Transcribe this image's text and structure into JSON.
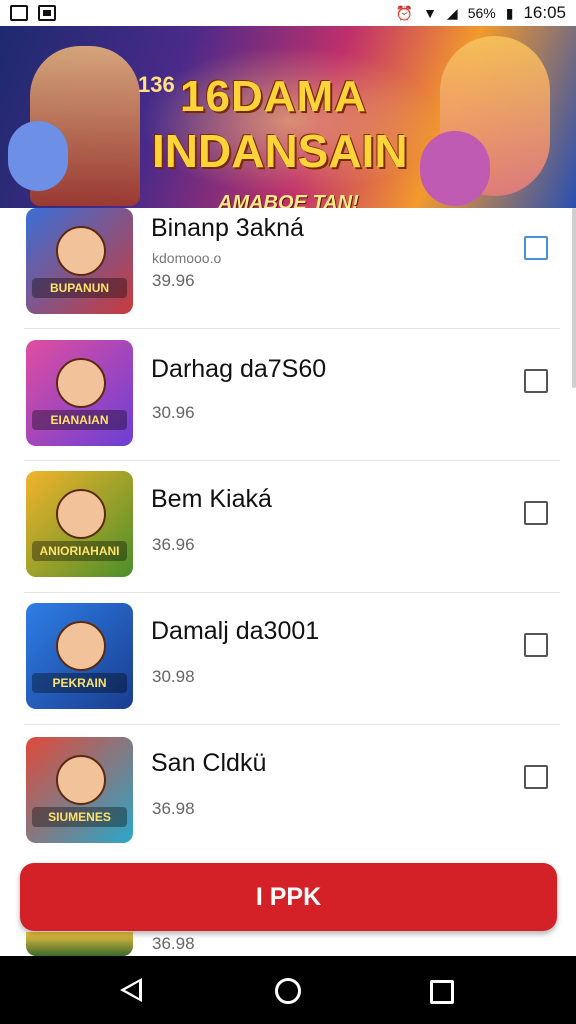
{
  "status_bar": {
    "battery": "56%",
    "time": "16:05"
  },
  "banner": {
    "tag": "136",
    "title_line1": "16DAMA",
    "title_line2": "INDANSAIN",
    "subtitle": "AMABOE TAN!"
  },
  "items": [
    {
      "title": "Binanp 3akná",
      "subtitle": "kdomooo.o",
      "price": "39.96",
      "thumb_text": "BUPANUN",
      "colors": [
        "#3a6fd8",
        "#c93b3b"
      ],
      "checkbox_style": "blue"
    },
    {
      "title": "Darhag da7S60",
      "price": "30.96",
      "thumb_text": "EIANAIAN",
      "colors": [
        "#e04ea0",
        "#6b3fd6"
      ]
    },
    {
      "title": "Bem Kiaká",
      "price": "36.96",
      "thumb_text": "ANIORIAHANI",
      "colors": [
        "#f3b32b",
        "#4a8f2a"
      ]
    },
    {
      "title": "Damalj da3001",
      "price": "30.98",
      "thumb_text": "PEKRAIN",
      "colors": [
        "#2e7ee6",
        "#1a3d8f"
      ]
    },
    {
      "title": "San Cldkü",
      "price": "36.98",
      "thumb_text": "SIUMENES",
      "colors": [
        "#e04a3a",
        "#2aa7c9"
      ]
    }
  ],
  "peek_item": {
    "price": "36.98"
  },
  "cta": {
    "label": "I PPK"
  },
  "colors": {
    "accent": "#d42027",
    "checkbox_focus": "#4a90d9"
  }
}
